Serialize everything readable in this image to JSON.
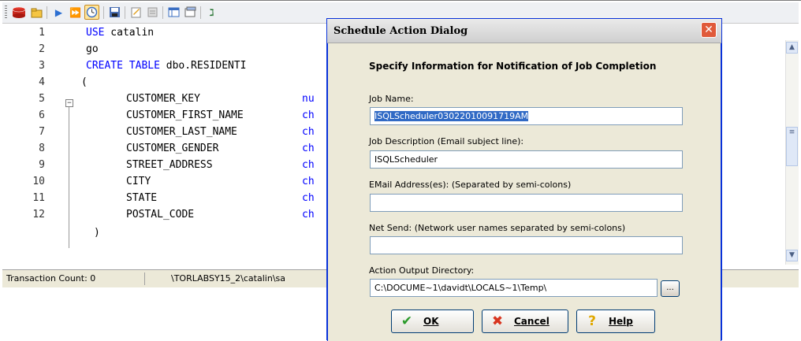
{
  "toolbar": {
    "icons": [
      "database-icon",
      "open-icon",
      "run-icon",
      "run-all-icon",
      "schedule-icon",
      "save-icon",
      "edit-icon",
      "disabled-icon",
      "grid-icon",
      "results-icon",
      "help-icon"
    ],
    "colors": {
      "accent": "#2c6fd1",
      "highlight": "#ffe59c"
    }
  },
  "editor": {
    "line_numbers": [
      "1",
      "2",
      "3",
      "4",
      "5",
      "6",
      "7",
      "8",
      "9",
      "10",
      "11",
      "12"
    ],
    "lines": [
      {
        "kw": "USE",
        "text": " catalin"
      },
      {
        "kw": "",
        "text": "go"
      },
      {
        "kw": "CREATE TABLE",
        "text": " dbo.RESIDENTI"
      },
      {
        "kw": "",
        "text": "("
      },
      {
        "kw": "",
        "text": "CUSTOMER_KEY",
        "tail": "nu"
      },
      {
        "kw": "",
        "text": "CUSTOMER_FIRST_NAME",
        "tail": "ch"
      },
      {
        "kw": "",
        "text": "CUSTOMER_LAST_NAME",
        "tail": "ch"
      },
      {
        "kw": "",
        "text": "CUSTOMER_GENDER",
        "tail": "ch"
      },
      {
        "kw": "",
        "text": "STREET_ADDRESS",
        "tail": "ch"
      },
      {
        "kw": "",
        "text": "CITY",
        "tail": "ch"
      },
      {
        "kw": "",
        "text": "STATE",
        "tail": "ch"
      },
      {
        "kw": "",
        "text": "POSTAL_CODE",
        "tail": "ch"
      },
      {
        "kw": "",
        "text": ")"
      }
    ]
  },
  "status": {
    "transaction_count": "Transaction Count: 0",
    "connection": "\\TORLABSY15_2\\catalin\\sa"
  },
  "dialog": {
    "title": "Schedule Action Dialog",
    "close_icon": "close-icon",
    "heading": "Specify Information for Notification of Job Completion",
    "job_name_label": "Job Name:",
    "job_name_value": "ISQLScheduler03022010091719AM",
    "job_desc_label": "Job Description (Email subject line):",
    "job_desc_value": "ISQLScheduler",
    "email_label": "EMail Address(es): (Separated by semi-colons)",
    "email_value": "",
    "netsend_label": "Net Send: (Network user names separated by semi-colons)",
    "netsend_value": "",
    "output_dir_label": "Action Output Directory:",
    "output_dir_value": "C:\\DOCUME~1\\davidt\\LOCALS~1\\Temp\\",
    "browse_label": "...",
    "ok_label": "OK",
    "cancel_label": "Cancel",
    "help_label": "Help"
  }
}
